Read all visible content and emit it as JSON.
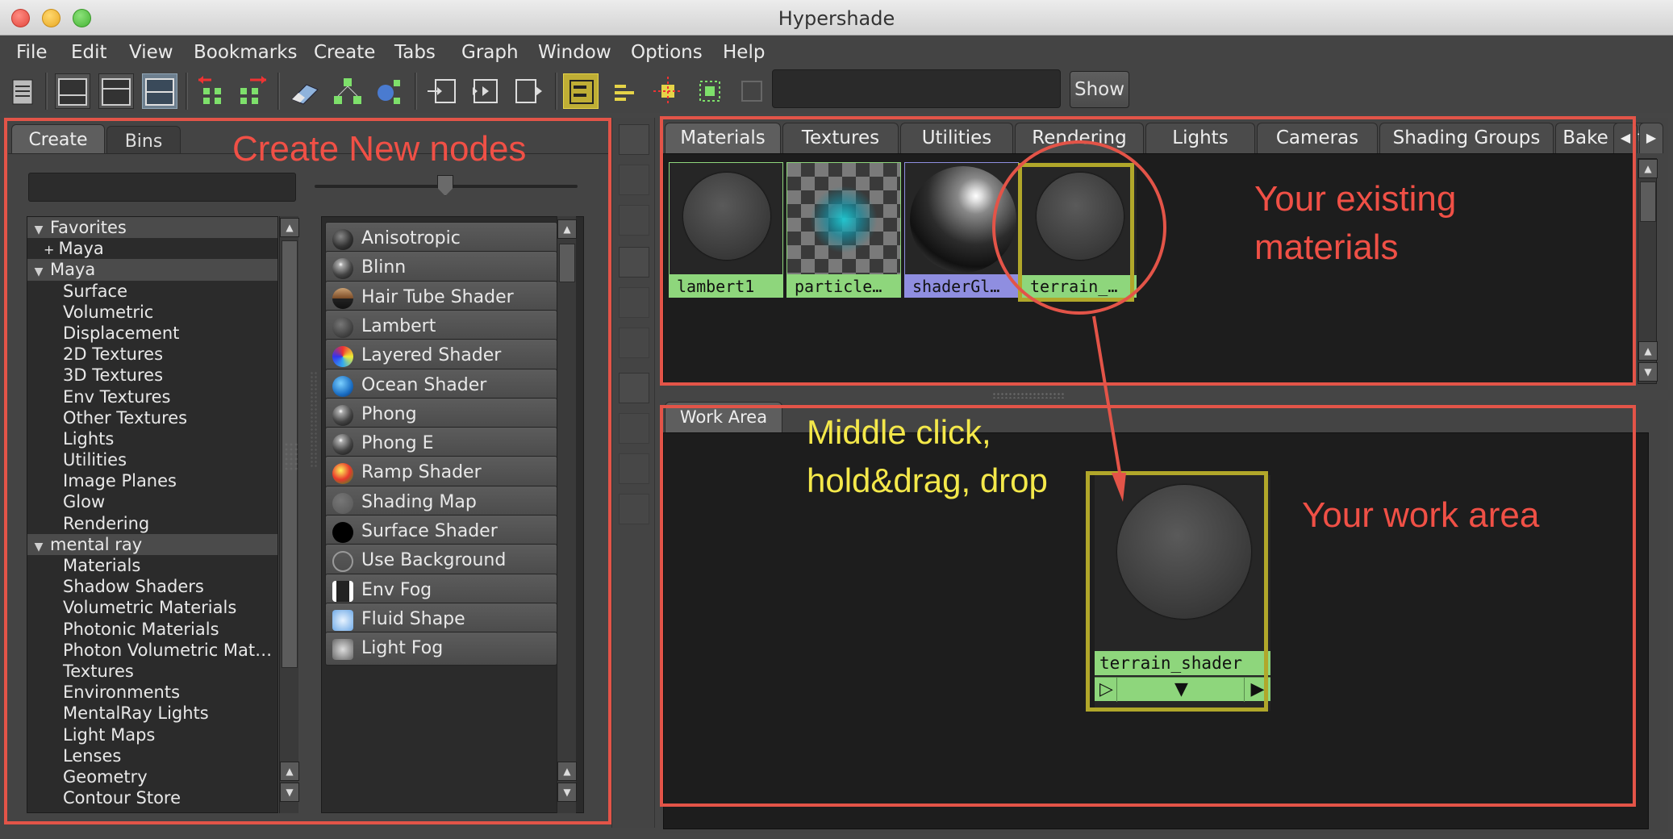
{
  "window": {
    "title": "Hypershade"
  },
  "menu": [
    "File",
    "Edit",
    "View",
    "Bookmarks",
    "Create",
    "Tabs",
    "Graph",
    "Window",
    "Options",
    "Help"
  ],
  "toolbar": {
    "show_label": "Show",
    "search_value": ""
  },
  "left_panel": {
    "tabs": [
      "Create",
      "Bins"
    ],
    "filter_value": "",
    "tree": [
      {
        "label": "Favorites",
        "kind": "cat"
      },
      {
        "label": "Maya",
        "kind": "plus"
      },
      {
        "label": "Maya",
        "kind": "cat"
      },
      {
        "label": "Surface",
        "kind": "child"
      },
      {
        "label": "Volumetric",
        "kind": "child"
      },
      {
        "label": "Displacement",
        "kind": "child"
      },
      {
        "label": "2D Textures",
        "kind": "child"
      },
      {
        "label": "3D Textures",
        "kind": "child"
      },
      {
        "label": "Env Textures",
        "kind": "child"
      },
      {
        "label": "Other Textures",
        "kind": "child"
      },
      {
        "label": "Lights",
        "kind": "child"
      },
      {
        "label": "Utilities",
        "kind": "child"
      },
      {
        "label": "Image Planes",
        "kind": "child"
      },
      {
        "label": "Glow",
        "kind": "child"
      },
      {
        "label": "Rendering",
        "kind": "child"
      },
      {
        "label": "mental ray",
        "kind": "cat"
      },
      {
        "label": "Materials",
        "kind": "child"
      },
      {
        "label": "Shadow Shaders",
        "kind": "child"
      },
      {
        "label": "Volumetric Materials",
        "kind": "child"
      },
      {
        "label": "Photonic Materials",
        "kind": "child"
      },
      {
        "label": "Photon Volumetric Mat…",
        "kind": "child"
      },
      {
        "label": "Textures",
        "kind": "child"
      },
      {
        "label": "Environments",
        "kind": "child"
      },
      {
        "label": "MentalRay Lights",
        "kind": "child"
      },
      {
        "label": "Light Maps",
        "kind": "child"
      },
      {
        "label": "Lenses",
        "kind": "child"
      },
      {
        "label": "Geometry",
        "kind": "child"
      },
      {
        "label": "Contour Store",
        "kind": "child"
      }
    ],
    "nodes": [
      {
        "label": "Anisotropic",
        "icon": "sphere-dark"
      },
      {
        "label": "Blinn",
        "icon": "sphere-shiny"
      },
      {
        "label": "Hair Tube Shader",
        "icon": "hair-tube"
      },
      {
        "label": "Lambert",
        "icon": "sphere-matte"
      },
      {
        "label": "Layered Shader",
        "icon": "layered"
      },
      {
        "label": "Ocean Shader",
        "icon": "ocean"
      },
      {
        "label": "Phong",
        "icon": "sphere-shiny"
      },
      {
        "label": "Phong E",
        "icon": "sphere-shiny"
      },
      {
        "label": "Ramp Shader",
        "icon": "ramp"
      },
      {
        "label": "Shading Map",
        "icon": "shading-map"
      },
      {
        "label": "Surface Shader",
        "icon": "surface"
      },
      {
        "label": "Use Background",
        "icon": "use-bg"
      },
      {
        "label": "Env Fog",
        "icon": "env-fog"
      },
      {
        "label": "Fluid Shape",
        "icon": "fluid"
      },
      {
        "label": "Light Fog",
        "icon": "light-fog"
      }
    ]
  },
  "materials_panel": {
    "tabs": [
      "Materials",
      "Textures",
      "Utilities",
      "Rendering",
      "Lights",
      "Cameras",
      "Shading Groups",
      "Bake Sets"
    ],
    "swatches": [
      {
        "label": "lambert1",
        "label_color": "#8ed67c",
        "kind": "sphere"
      },
      {
        "label": "particle…",
        "label_color": "#8ed67c",
        "kind": "checker"
      },
      {
        "label": "shaderGl…",
        "label_color": "#8f8ee0",
        "kind": "chrome"
      },
      {
        "label": "terrain_…",
        "label_color": "#8ed67c",
        "kind": "sphere"
      }
    ]
  },
  "work_area": {
    "tab": "Work Area",
    "node": {
      "label": "terrain_shader",
      "ports": [
        "▷",
        "▼",
        "▶"
      ]
    }
  },
  "annotations": {
    "create_new_nodes": "Create New nodes",
    "existing_materials_line1": "Your existing",
    "existing_materials_line2": "materials",
    "middle_click_line1": "Middle click,",
    "middle_click_line2": "hold&drag, drop",
    "work_area": "Your work area",
    "colors": {
      "red": "#f05046",
      "yellow": "#f4e84a",
      "olive": "#b1a72a"
    }
  }
}
